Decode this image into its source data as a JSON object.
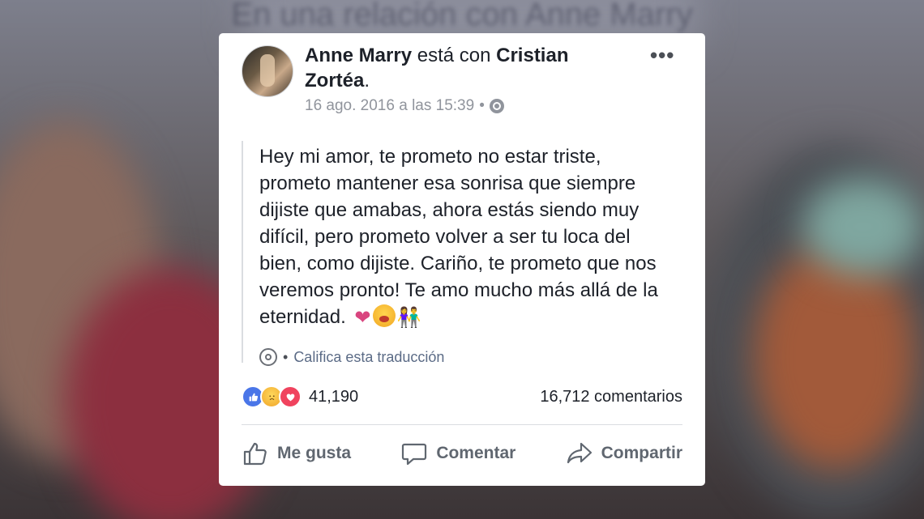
{
  "background": {
    "title": "En una relación con Anne Marry"
  },
  "post": {
    "author": "Anne Marry",
    "with_text": "está con",
    "tagged": "Cristian Zortéa",
    "tagged_suffix": ".",
    "timestamp": "16 ago. 2016 a las 15:39",
    "separator": "•",
    "privacy_icon": "globe-icon",
    "more_label": "•••",
    "text": "Hey mi amor, te prometo no estar triste, prometo mantener esa sonrisa que siempre dijiste que amabas, ahora estás siendo muy difícil, pero prometo volver a ser tu loca del bien, como dijiste. Cariño, te prometo que nos veremos pronto! Te amo mucho más allá de la eternidad.",
    "emojis": {
      "heart": "❤",
      "kids": "👫"
    },
    "translation": {
      "separator": "•",
      "label": "Califica esta traducción"
    }
  },
  "stats": {
    "reactions": [
      "like-icon",
      "sad-icon",
      "love-icon"
    ],
    "reaction_count": "41,190",
    "comments": "16,712 comentarios"
  },
  "actions": {
    "like": "Me gusta",
    "comment": "Comentar",
    "share": "Compartir"
  },
  "colors": {
    "text": "#1d2129",
    "meta": "#90949c",
    "like_blue": "#4a76e8",
    "love_red": "#f0435e",
    "heart_pink": "#d9457f"
  }
}
